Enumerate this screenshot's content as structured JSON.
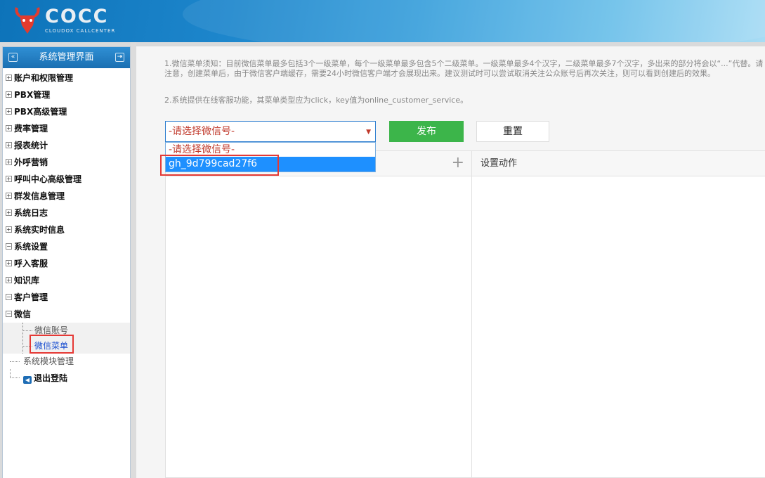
{
  "app": {
    "brand": "COCC",
    "brand_sub": "CLOUDOX CALLCENTER"
  },
  "sidebar": {
    "title": "系统管理界面",
    "items": [
      {
        "label": "账户和权限管理",
        "toggle": "+"
      },
      {
        "label": "PBX管理",
        "toggle": "+"
      },
      {
        "label": "PBX高级管理",
        "toggle": "+"
      },
      {
        "label": "费率管理",
        "toggle": "+"
      },
      {
        "label": "报表统计",
        "toggle": "+"
      },
      {
        "label": "外呼营销",
        "toggle": "+"
      },
      {
        "label": "呼叫中心高级管理",
        "toggle": "+"
      },
      {
        "label": "群发信息管理",
        "toggle": "+"
      },
      {
        "label": "系统日志",
        "toggle": "+"
      },
      {
        "label": "系统实时信息",
        "toggle": "+"
      },
      {
        "label": "系统设置",
        "toggle": "−"
      },
      {
        "label": "呼入客服",
        "toggle": "+"
      },
      {
        "label": "知识库",
        "toggle": "+"
      },
      {
        "label": "客户管理",
        "toggle": "−"
      },
      {
        "label": "微信",
        "toggle": "−"
      }
    ],
    "wechat_children": [
      "微信账号",
      "微信菜单"
    ],
    "module_item": "系统模块管理",
    "logout": "退出登陆"
  },
  "main": {
    "note1": "1.微信菜单须知：目前微信菜单最多包括3个一级菜单，每个一级菜单最多包含5个二级菜单。一级菜单最多4个汉字，二级菜单最多7个汉字，多出来的部分将会以“...”代替。请注意，创建菜单后，由于微信客户端缓存，需要24小时微信客户端才会展现出来。建议测试时可以尝试取消关注公众账号后再次关注，则可以看到创建后的效果。",
    "note2": "2.系统提供在线客服功能，其菜单类型应为click，key值为online_customer_service。",
    "select": {
      "value": "-请选择微信号-",
      "options": [
        "-请选择微信号-",
        "gh_9d799cad27f6"
      ],
      "highlighted": "gh_9d799cad27f6"
    },
    "publish_label": "发布",
    "reset_label": "重置",
    "right_header": "设置动作"
  },
  "colors": {
    "accent": "#1e90ff",
    "publish": "#3cb54a",
    "highlight_box": "#e53935"
  }
}
